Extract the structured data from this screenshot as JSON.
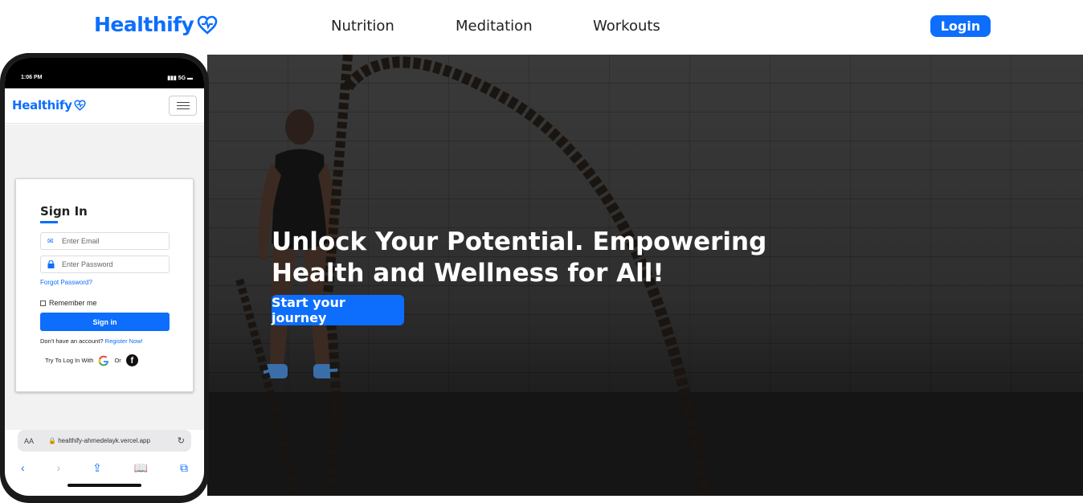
{
  "header": {
    "brand": "Healthify",
    "nav": [
      "Nutrition",
      "Meditation",
      "Workouts"
    ],
    "login_label": "Login"
  },
  "hero": {
    "title": "Unlock Your Potential. Empowering Health and Wellness for All!",
    "cta_label": "Start your journey"
  },
  "phone": {
    "status_time": "1:06 PM",
    "status_signal": "5G",
    "brand": "Healthify",
    "signin": {
      "title": "Sign In",
      "email_placeholder": "Enter Email",
      "password_placeholder": "Enter Password",
      "forgot": "Forgot Password?",
      "remember": "Remember me",
      "button": "Sign in",
      "no_account": "Don't have an account?",
      "register": "Register Now!",
      "try_text": "Try To Log In With",
      "or": "Or"
    },
    "url_aa": "AA",
    "url": "healthify-ahmedelayk.vercel.app"
  },
  "colors": {
    "primary": "#0d6efd",
    "hero_bg": "#2e2e2e"
  },
  "icons": [
    "heart-pulse-icon",
    "menu-icon",
    "mail-icon",
    "lock-icon",
    "google-icon",
    "facebook-icon",
    "reload-icon",
    "back-icon",
    "forward-icon",
    "share-icon",
    "bookmarks-icon",
    "tabs-icon"
  ]
}
